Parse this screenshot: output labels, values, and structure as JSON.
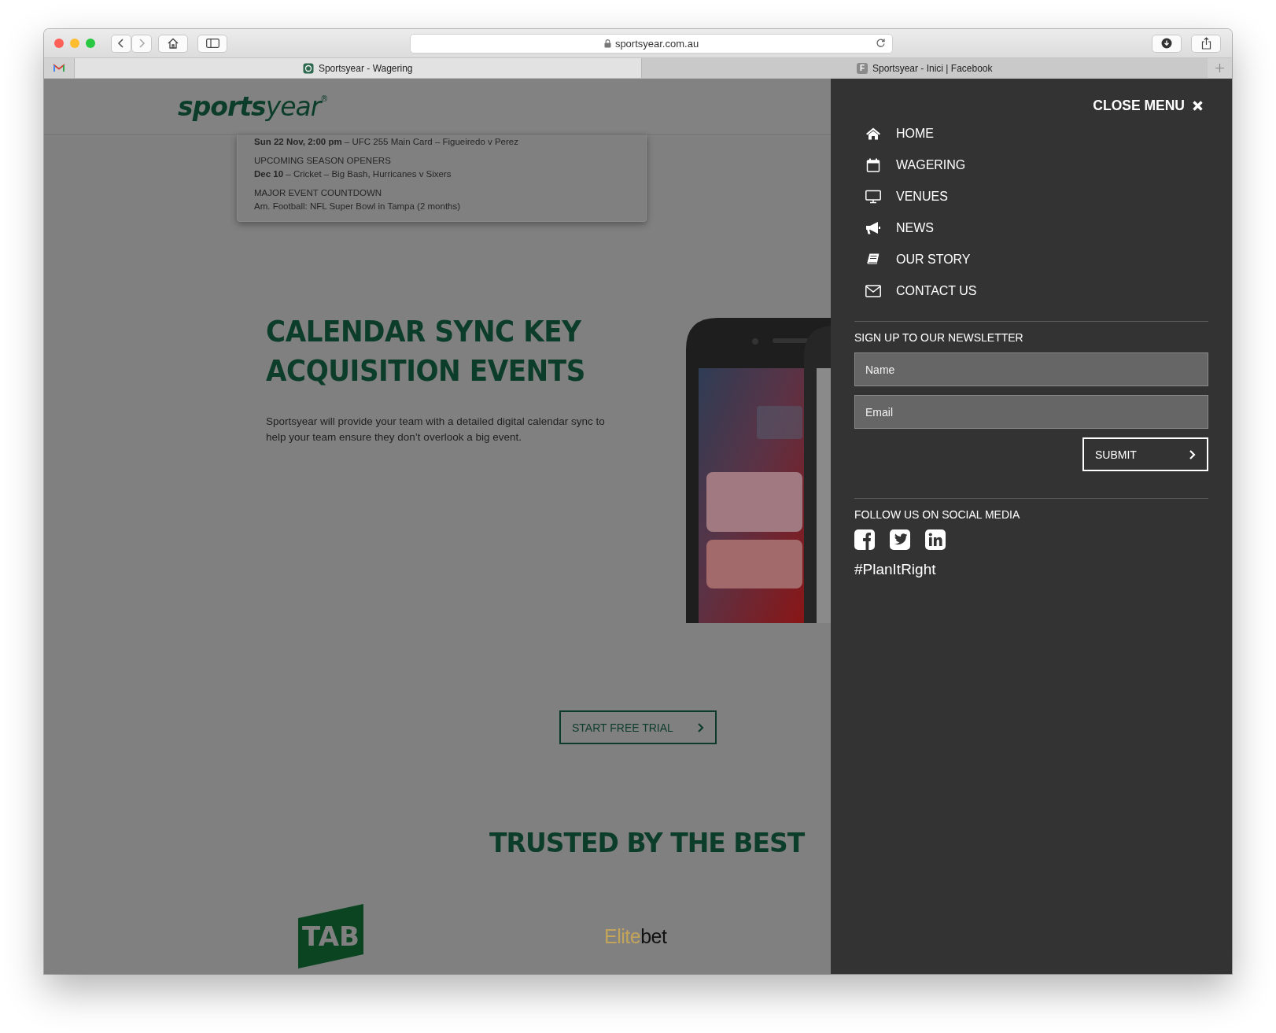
{
  "browser": {
    "url": "sportsyear.com.au",
    "tabs": [
      {
        "title": "Sportsyear - Wagering",
        "selected": true,
        "kind": "logo"
      },
      {
        "title": "Sportsyear - Inici | Facebook",
        "selected": false,
        "kind": "letter",
        "favicon_letter": "F"
      }
    ]
  },
  "header": {
    "logo": "**sports**year$^{®}$"
  },
  "events": [
    {
      "text": "**Sun 22 Nov, 2:00 pm** – UFC 255 Main Card – Figueiredo v Perez"
    },
    {
      "heading": "UPCOMING SEASON OPENERS",
      "text": "**Dec 10** – Cricket – Big Bash, Hurricanes v Sixers"
    },
    {
      "heading": "MAJOR EVENT COUNTDOWN",
      "text": "Am. Football: NFL Super Bowl in Tampa (2 months)"
    }
  ],
  "hero": {
    "title_lines": [
      "CALENDAR SYNC KEY",
      "ACQUISITION EVENTS"
    ],
    "body": "Sportsyear will provide your team with a detailed digital calendar sync to help your team ensure they don’t overlook a big event.",
    "image": {
      "kind": "picture"
    }
  },
  "trial_button": "START FREE TRIAL",
  "trusted": {
    "heading": "TRUSTED BY THE BEST",
    "partners": [
      {
        "kind": "tab",
        "text": "TAB"
      },
      {
        "kind": "elitebet",
        "parts": [
          "Elite",
          "bet"
        ]
      }
    ]
  },
  "menu": {
    "close_label": "CLOSE MENU",
    "items": [
      {
        "label": "HOME"
      },
      {
        "label": "WAGERING"
      },
      {
        "label": "VENUES"
      },
      {
        "label": "NEWS"
      },
      {
        "label": "OUR STORY"
      },
      {
        "label": "CONTACT US"
      }
    ],
    "newsletter": {
      "heading": "SIGN UP TO OUR NEWSLETTER",
      "fields": [
        {
          "placeholder": "Name"
        },
        {
          "placeholder": "Email"
        }
      ],
      "submit": "SUBMIT"
    },
    "social": {
      "heading": "FOLLOW US ON SOCIAL MEDIA",
      "hashtag": "#PlanItRight"
    }
  }
}
